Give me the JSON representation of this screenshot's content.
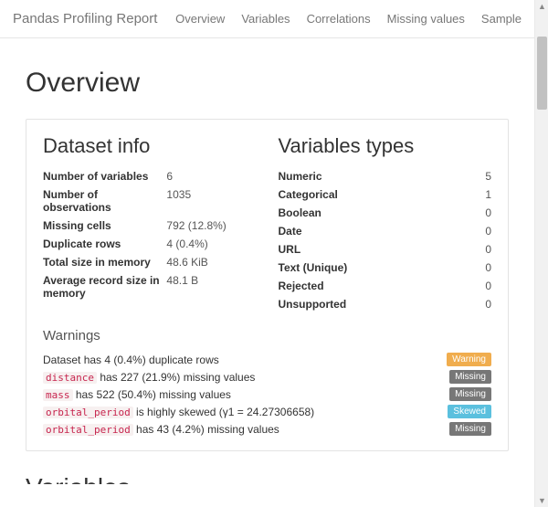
{
  "nav": {
    "brand": "Pandas Profiling Report",
    "links": [
      "Overview",
      "Variables",
      "Correlations",
      "Missing values",
      "Sample"
    ]
  },
  "page_title": "Overview",
  "dataset_info": {
    "heading": "Dataset info",
    "rows": [
      {
        "label": "Number of variables",
        "value": "6"
      },
      {
        "label": "Number of observations",
        "value": "1035"
      },
      {
        "label": "Missing cells",
        "value": "792 (12.8%)"
      },
      {
        "label": "Duplicate rows",
        "value": "4 (0.4%)"
      },
      {
        "label": "Total size in memory",
        "value": "48.6 KiB"
      },
      {
        "label": "Average record size in memory",
        "value": "48.1 B"
      }
    ]
  },
  "var_types": {
    "heading": "Variables types",
    "rows": [
      {
        "label": "Numeric",
        "value": "5"
      },
      {
        "label": "Categorical",
        "value": "1"
      },
      {
        "label": "Boolean",
        "value": "0"
      },
      {
        "label": "Date",
        "value": "0"
      },
      {
        "label": "URL",
        "value": "0"
      },
      {
        "label": "Text (Unique)",
        "value": "0"
      },
      {
        "label": "Rejected",
        "value": "0"
      },
      {
        "label": "Unsupported",
        "value": "0"
      }
    ]
  },
  "warnings": {
    "heading": "Warnings",
    "items": [
      {
        "code": "",
        "pre": "Dataset has 4 (0.4%) duplicate rows",
        "post": "",
        "badge": "Warning",
        "badge_kind": "warning"
      },
      {
        "code": "distance",
        "pre": "",
        "post": " has 227 (21.9%) missing values",
        "badge": "Missing",
        "badge_kind": "missing"
      },
      {
        "code": "mass",
        "pre": "",
        "post": " has 522 (50.4%) missing values",
        "badge": "Missing",
        "badge_kind": "missing"
      },
      {
        "code": "orbital_period",
        "pre": "",
        "post": " is highly skewed (γ1 = 24.27306658)",
        "badge": "Skewed",
        "badge_kind": "skewed"
      },
      {
        "code": "orbital_period",
        "pre": "",
        "post": " has 43 (4.2%) missing values",
        "badge": "Missing",
        "badge_kind": "missing"
      }
    ]
  },
  "next_section_peek": "Variables"
}
